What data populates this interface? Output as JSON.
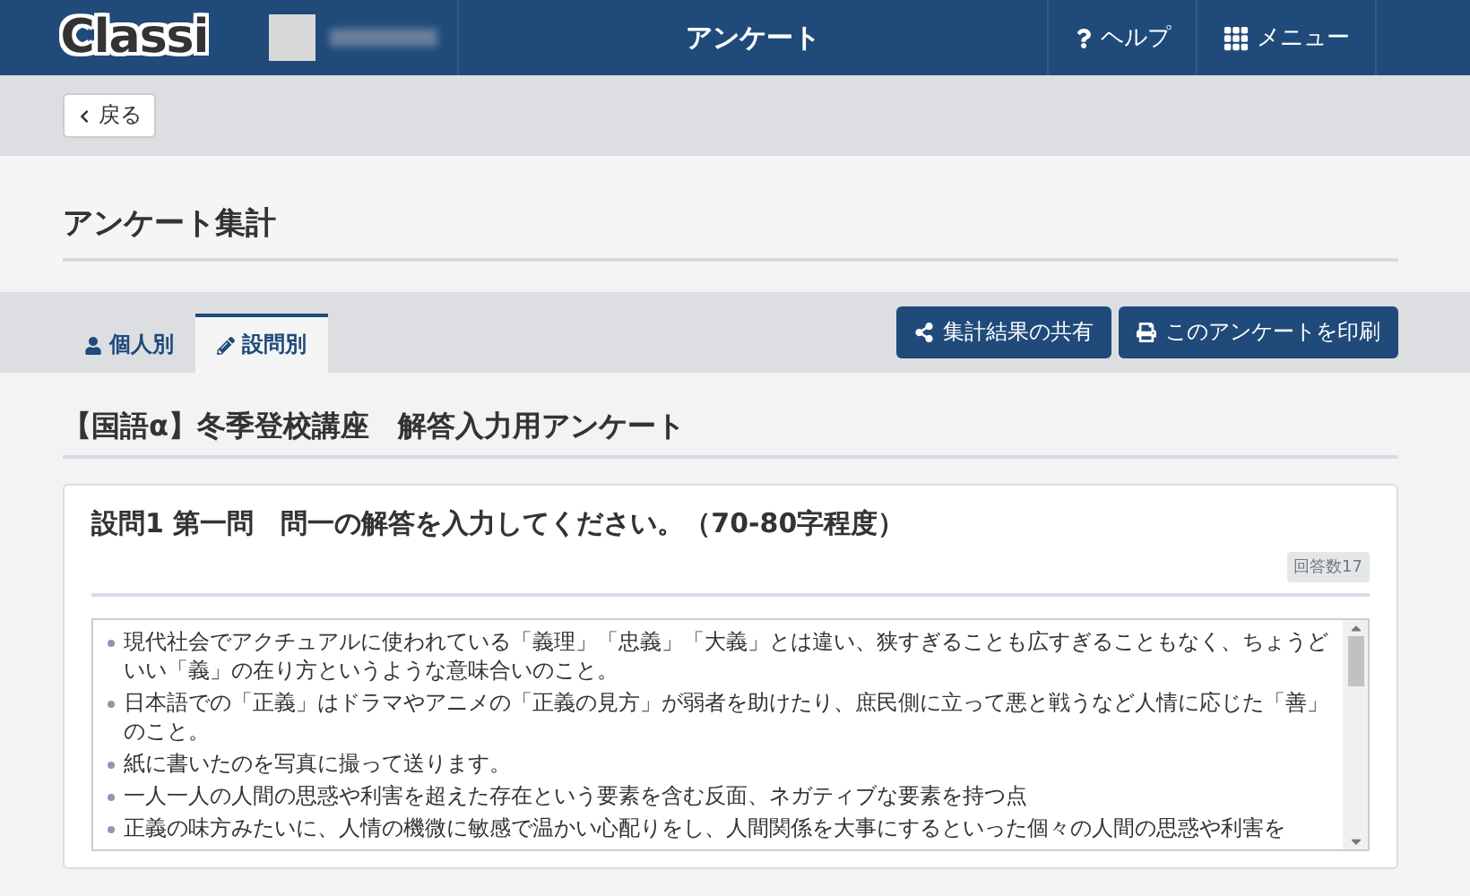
{
  "header": {
    "logo": "Classi",
    "title": "アンケート",
    "help": "ヘルプ",
    "menu": "メニュー"
  },
  "back_button": "戻る",
  "page_title": "アンケート集計",
  "tabs": [
    {
      "label": "個人別",
      "kind": "user",
      "selected": false
    },
    {
      "label": "設問別",
      "kind": "pencil",
      "selected": true
    }
  ],
  "actions": [
    {
      "label": "集計結果の共有",
      "kind": "share"
    },
    {
      "label": "このアンケートを印刷",
      "kind": "print"
    }
  ],
  "survey_title": "【国語α】冬季登校講座　解答入力用アンケート",
  "question": {
    "title": "設問1  第一問　問一の解答を入力してください。（70-80字程度）",
    "answer_count": "回答数17",
    "answers": [
      "現代社会でアクチュアルに使われている「義理」「忠義」「大義」とは違い、狭すぎることも広すぎることもなく、ちょうどいい「義」の在り方というような意味合いのこと。",
      "日本語での「正義」はドラマやアニメの「正義の見方」が弱者を助けたり、庶民側に立って悪と戦うなど人情に応じた「善」のこと。",
      "紙に書いたのを写真に撮って送ります。",
      "一人一人の人間の思惑や利害を超えた存在という要素を含む反面、ネガティブな要素を持つ点",
      "正義の味方みたいに、人情の機微に敏感で温かい心配りをし、人間関係を大事にするといった個々の人間の思惑や利害を"
    ]
  }
}
